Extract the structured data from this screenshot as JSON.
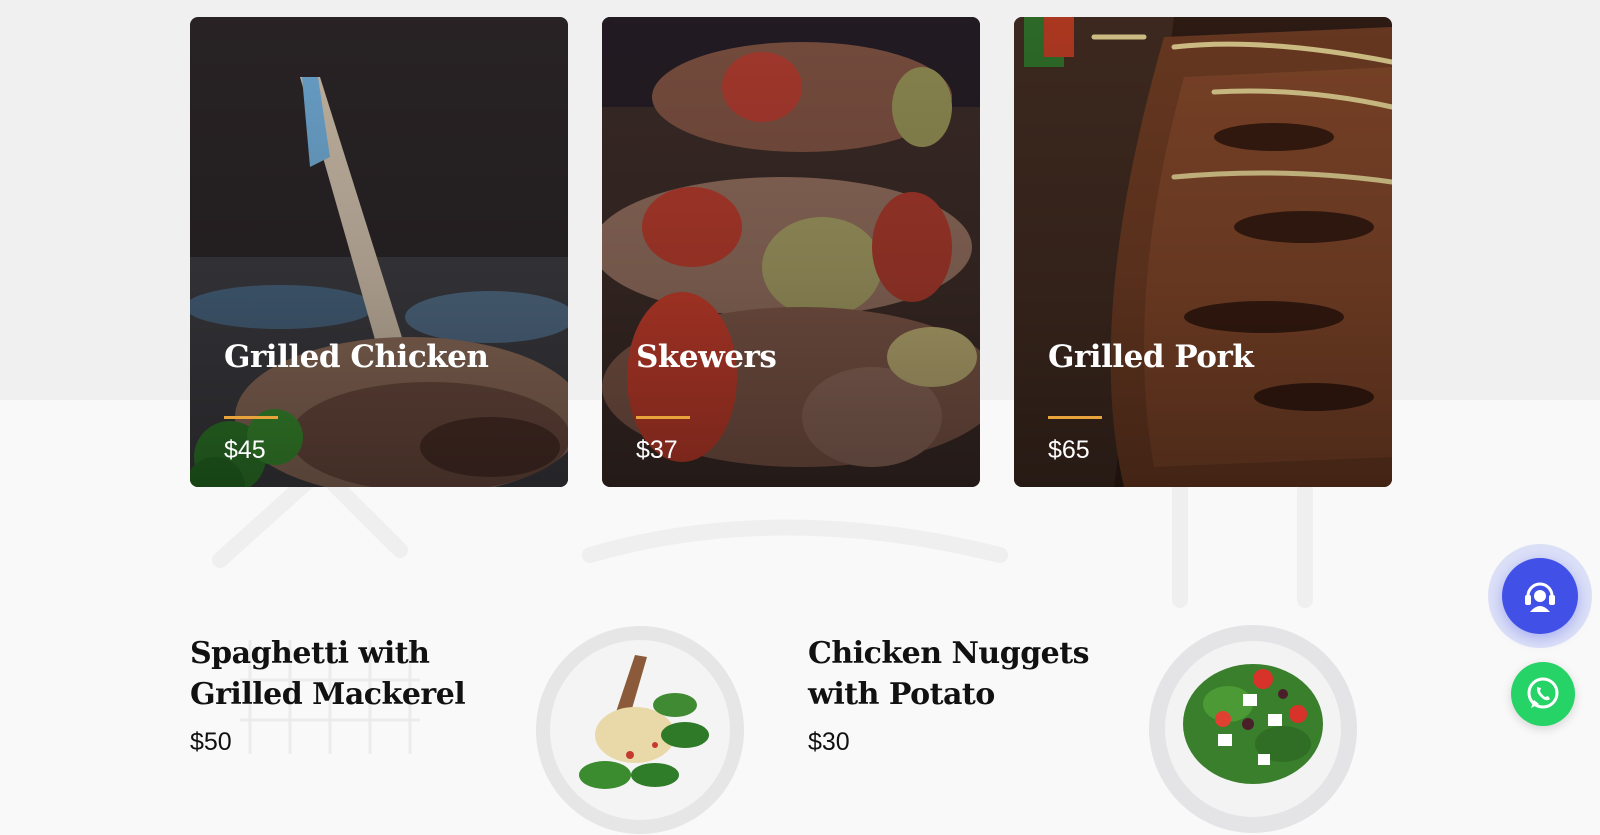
{
  "featured": [
    {
      "title": "Grilled Chicken",
      "price": "$45"
    },
    {
      "title": "Skewers",
      "price": "$37"
    },
    {
      "title": "Grilled Pork",
      "price": "$65"
    }
  ],
  "menu_items": [
    {
      "title_line1": "Spaghetti with",
      "title_line2": "Grilled Mackerel",
      "price": "$50"
    },
    {
      "title_line1": "Chicken Nuggets",
      "title_line2": "with Potato",
      "price": "$30"
    }
  ],
  "colors": {
    "accent_rule": "#e8a33b",
    "support_button": "#4150e6",
    "whatsapp_button": "#25d366"
  },
  "icons": {
    "support": "headset-support-icon",
    "whatsapp": "whatsapp-icon"
  }
}
